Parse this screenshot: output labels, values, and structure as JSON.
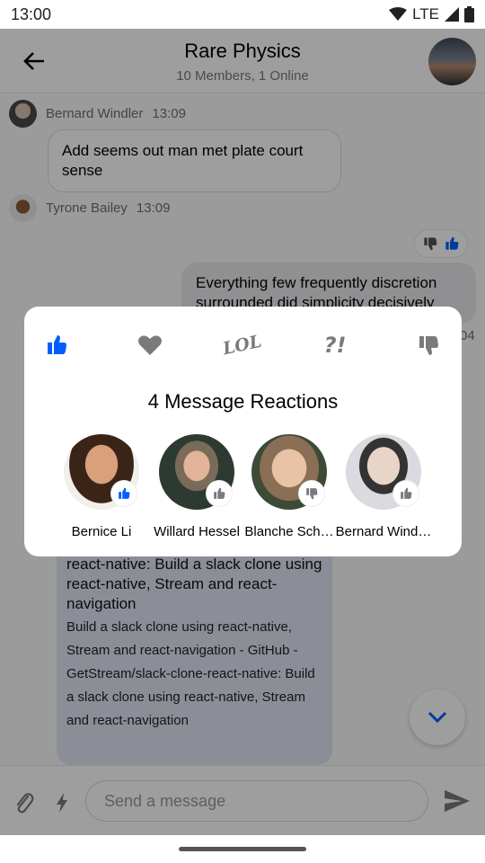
{
  "status_bar": {
    "time": "13:00",
    "network": "LTE"
  },
  "header": {
    "title": "Rare Physics",
    "subtitle": "10 Members, 1 Online"
  },
  "messages": {
    "first": {
      "author": "Bernard Windler",
      "time": "13:09",
      "text": "Add seems out man met plate court sense"
    },
    "second": {
      "author": "Tyrone Bailey",
      "time": "13:09"
    },
    "own": {
      "text": "Everything few frequently discretion surrounded did simplicity decisively",
      "time": "04"
    },
    "link": {
      "title": "GitHub - GetStream/ slack-clone-react-native: Build a slack clone using react-native, Stream and react-navigation",
      "description": "Build a slack clone using react-native, Stream and react-navigation - GitHub - GetStream/slack-clone-react-native: Build a slack clone using react-native, Stream and react-navigation"
    }
  },
  "composer": {
    "placeholder": "Send a message"
  },
  "modal": {
    "title": "4 Message Reactions",
    "reaction_options": [
      {
        "icon": "thumbs-up-icon",
        "selected": true
      },
      {
        "icon": "heart-icon",
        "selected": false
      },
      {
        "icon": "lol-icon",
        "label": "LOL",
        "selected": false
      },
      {
        "icon": "wow-icon",
        "label": "?!",
        "selected": false
      },
      {
        "icon": "thumbs-down-icon",
        "selected": false
      }
    ],
    "users": [
      {
        "name": "Bernice Li",
        "reaction": "thumbs-up-icon"
      },
      {
        "name": "Willard Hessel",
        "reaction": "thumbs-up-icon"
      },
      {
        "name": "Blanche Sch…",
        "reaction": "thumbs-down-icon"
      },
      {
        "name": "Bernard Wind…",
        "reaction": "thumbs-up-icon"
      }
    ]
  },
  "colors": {
    "accent": "#005fff",
    "icon_grey": "#7a7a7a",
    "link_card": "#e1e6f4"
  }
}
